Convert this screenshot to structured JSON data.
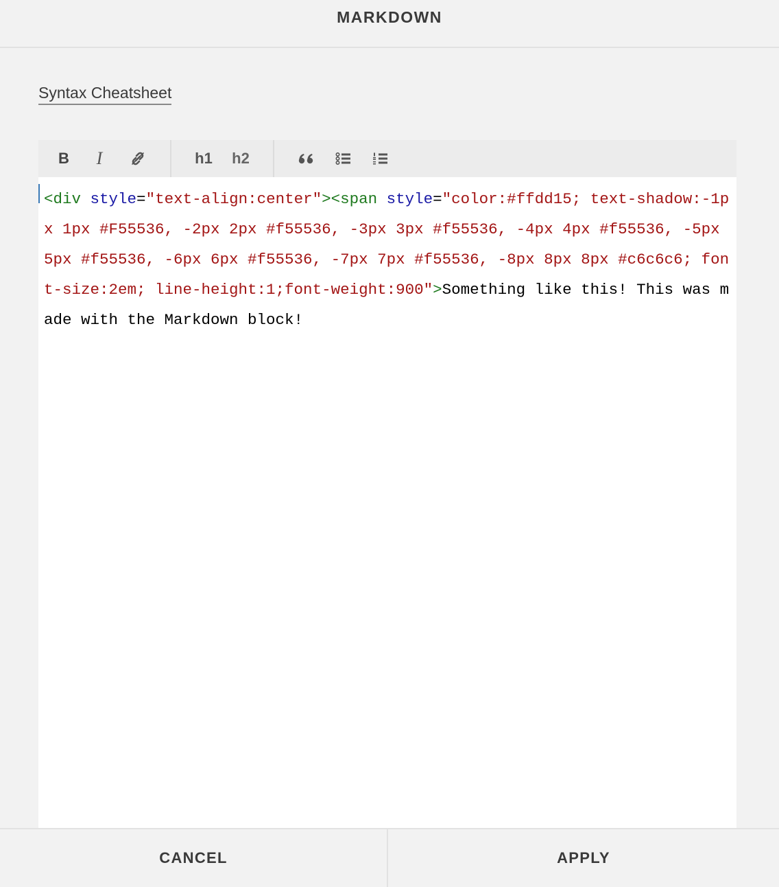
{
  "dialog": {
    "title": "MARKDOWN"
  },
  "links": {
    "cheatsheet": "Syntax Cheatsheet"
  },
  "toolbar": {
    "bold_label": "B",
    "italic_label": "I",
    "h1_label": "h1",
    "h2_label": "h2",
    "icons": [
      "bold-icon",
      "italic-icon",
      "link-icon",
      "h1-icon",
      "h2-icon",
      "quote-icon",
      "bulleted-list-icon",
      "numbered-list-icon"
    ]
  },
  "editor": {
    "tokens": [
      {
        "type": "tag",
        "text": "<div"
      },
      {
        "type": "text",
        "text": " "
      },
      {
        "type": "attr",
        "text": "style"
      },
      {
        "type": "text",
        "text": "="
      },
      {
        "type": "str",
        "text": "\"text-align:center\""
      },
      {
        "type": "tag",
        "text": "><span"
      },
      {
        "type": "text",
        "text": " "
      },
      {
        "type": "attr",
        "text": "style"
      },
      {
        "type": "text",
        "text": "="
      },
      {
        "type": "str",
        "text": "\"color:#ffdd15; text-shadow:-1px 1px #F55536, -2px 2px #f55536, -3px 3px #f55536, -4px 4px #f55536, -5px 5px #f55536, -6px 6px #f55536, -7px 7px #f55536, -8px 8px 8px #c6c6c6; font-size:2em; line-height:1;font-weight:900\""
      },
      {
        "type": "tag",
        "text": ">"
      },
      {
        "type": "text",
        "text": "Something like this! This was made with the Markdown block!"
      }
    ]
  },
  "footer": {
    "cancel_label": "CANCEL",
    "apply_label": "APPLY"
  },
  "colors": {
    "tag": "#1f7a1f",
    "attr": "#1a1aa6",
    "string": "#a31515",
    "caret": "#3b7ab7"
  }
}
